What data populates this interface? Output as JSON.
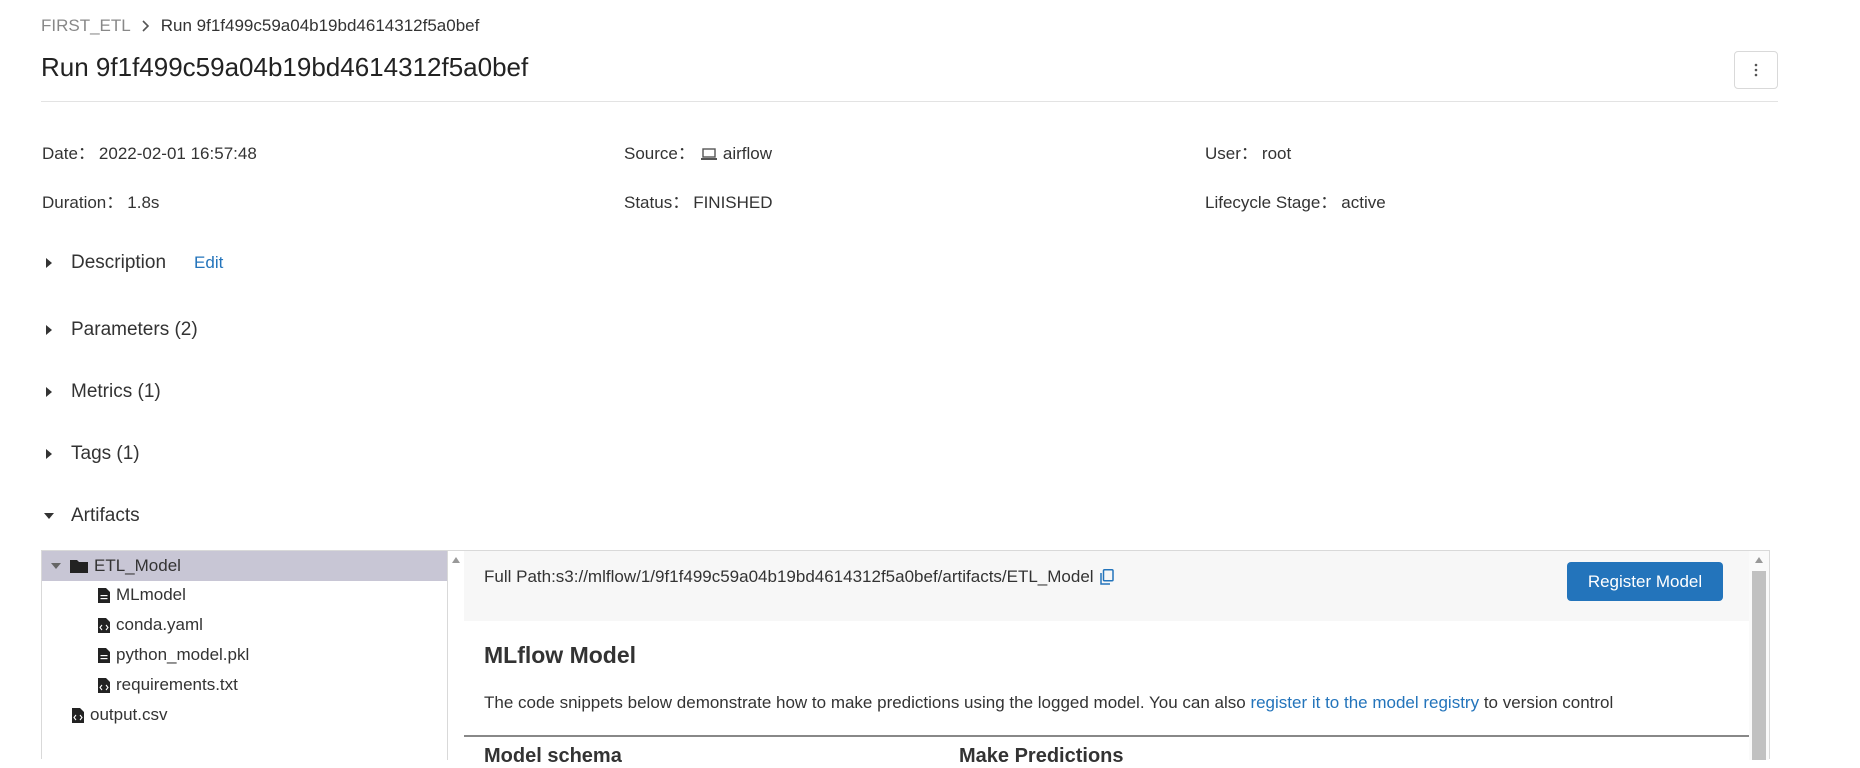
{
  "breadcrumb": {
    "experiment": "FIRST_ETL",
    "current": "Run 9f1f499c59a04b19bd4614312f5a0bef"
  },
  "page_title": "Run 9f1f499c59a04b19bd4614312f5a0bef",
  "menu_icon": "more-vertical-icon",
  "meta": {
    "date": {
      "label": "Date：",
      "value": "2022-02-01 16:57:48"
    },
    "source": {
      "label": "Source：",
      "value": "airflow",
      "icon": "laptop-icon"
    },
    "user": {
      "label": "User：",
      "value": "root"
    },
    "duration": {
      "label": "Duration：",
      "value": "1.8s"
    },
    "status": {
      "label": "Status：",
      "value": "FINISHED"
    },
    "lifecycle": {
      "label": "Lifecycle Stage：",
      "value": "active"
    }
  },
  "sections": {
    "description": {
      "label": "Description",
      "edit": "Edit"
    },
    "parameters": {
      "label": "Parameters (2)"
    },
    "metrics": {
      "label": "Metrics (1)"
    },
    "tags": {
      "label": "Tags (1)"
    },
    "artifacts": {
      "label": "Artifacts"
    }
  },
  "artifact_tree": {
    "folder": {
      "name": "ETL_Model",
      "expanded": true,
      "selected": true
    },
    "children": [
      "MLmodel",
      "conda.yaml",
      "python_model.pkl",
      "requirements.txt"
    ],
    "root_files": [
      "output.csv"
    ]
  },
  "artifact_detail": {
    "full_path": "Full Path:s3://mlflow/1/9f1f499c59a04b19bd4614312f5a0bef/artifacts/ETL_Model",
    "register_button": "Register Model",
    "model_title": "MLflow Model",
    "desc_before": "The code snippets below demonstrate how to make predictions using the logged model. You can also ",
    "desc_link": "register it to the model registry",
    "desc_after": " to version control",
    "cut_left": "Model schema",
    "cut_right": "Make Predictions"
  },
  "colors": {
    "accent": "#2374bb",
    "selected_row": "#c8c6d5"
  }
}
